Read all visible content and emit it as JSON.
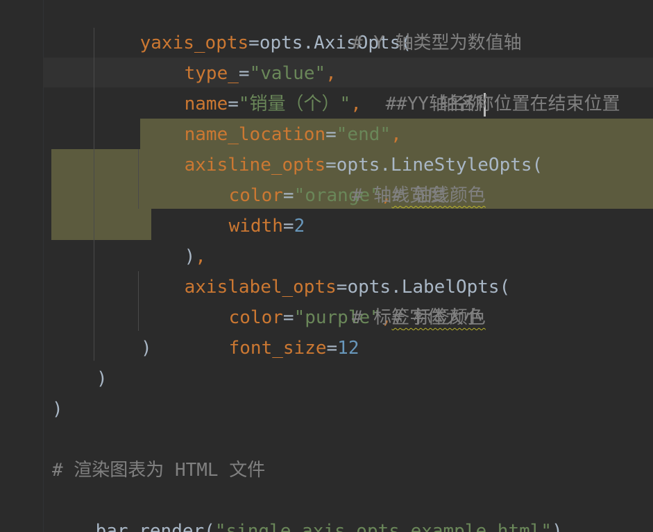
{
  "editor": {
    "language": "python",
    "colors": {
      "background": "#2b2b2b",
      "keyword_param": "#cc7832",
      "string": "#6a8759",
      "number": "#6897bb",
      "comment": "#808080",
      "selection": "#5c5b3e"
    },
    "lines": {
      "l1": {
        "name": "yaxis_opts",
        "eq": "=",
        "rest": "opts.AxisOpts("
      },
      "l2": {
        "name": "type_",
        "eq": "=",
        "str": "\"value\"",
        "comma": ",",
        "cmt": "# Y 轴类型为数值轴"
      },
      "l3": {
        "name": "name",
        "eq": "=",
        "str": "\"销量（个）\"",
        "comma": ",",
        "cmt": "# Y 轴名称"
      },
      "l4": {
        "name": "name_location",
        "eq": "=",
        "str": "\"end\"",
        "comma": ",",
        "cmt": "# Y 轴名称位置在结束位置"
      },
      "l5": {
        "name": "axisline_opts",
        "eq": "=",
        "rest": "opts.LineStyleOpts("
      },
      "l6": {
        "name": "color",
        "eq": "=",
        "str": "\"orange\"",
        "comma": ",",
        "cmt_hash": "#",
        "cmt": " 轴线颜色"
      },
      "l7": {
        "name": "width",
        "eq": "=",
        "num": "2",
        "cmt": "# 轴线宽度"
      },
      "l8": {
        "text": ")",
        "comma": ","
      },
      "l9": {
        "name": "axislabel_opts",
        "eq": "=",
        "rest": "opts.LabelOpts("
      },
      "l10": {
        "name": "color",
        "eq": "=",
        "str": "\"purple\"",
        "comma": ",",
        "cmt_hash": "#",
        "cmt": " 标签颜色"
      },
      "l11": {
        "name": "font_size",
        "eq": "=",
        "num": "12",
        "cmt": "# 标签字体大小"
      },
      "l12": {
        "text": ")"
      },
      "l13": {
        "text": ")"
      },
      "l14": {
        "text": ")"
      },
      "l16": {
        "cmt": "# 渲染图表为 HTML 文件"
      },
      "l17": {
        "obj": "bar.render(",
        "str": "\"single_axis_opts_example.html\"",
        "close": ")"
      }
    }
  }
}
